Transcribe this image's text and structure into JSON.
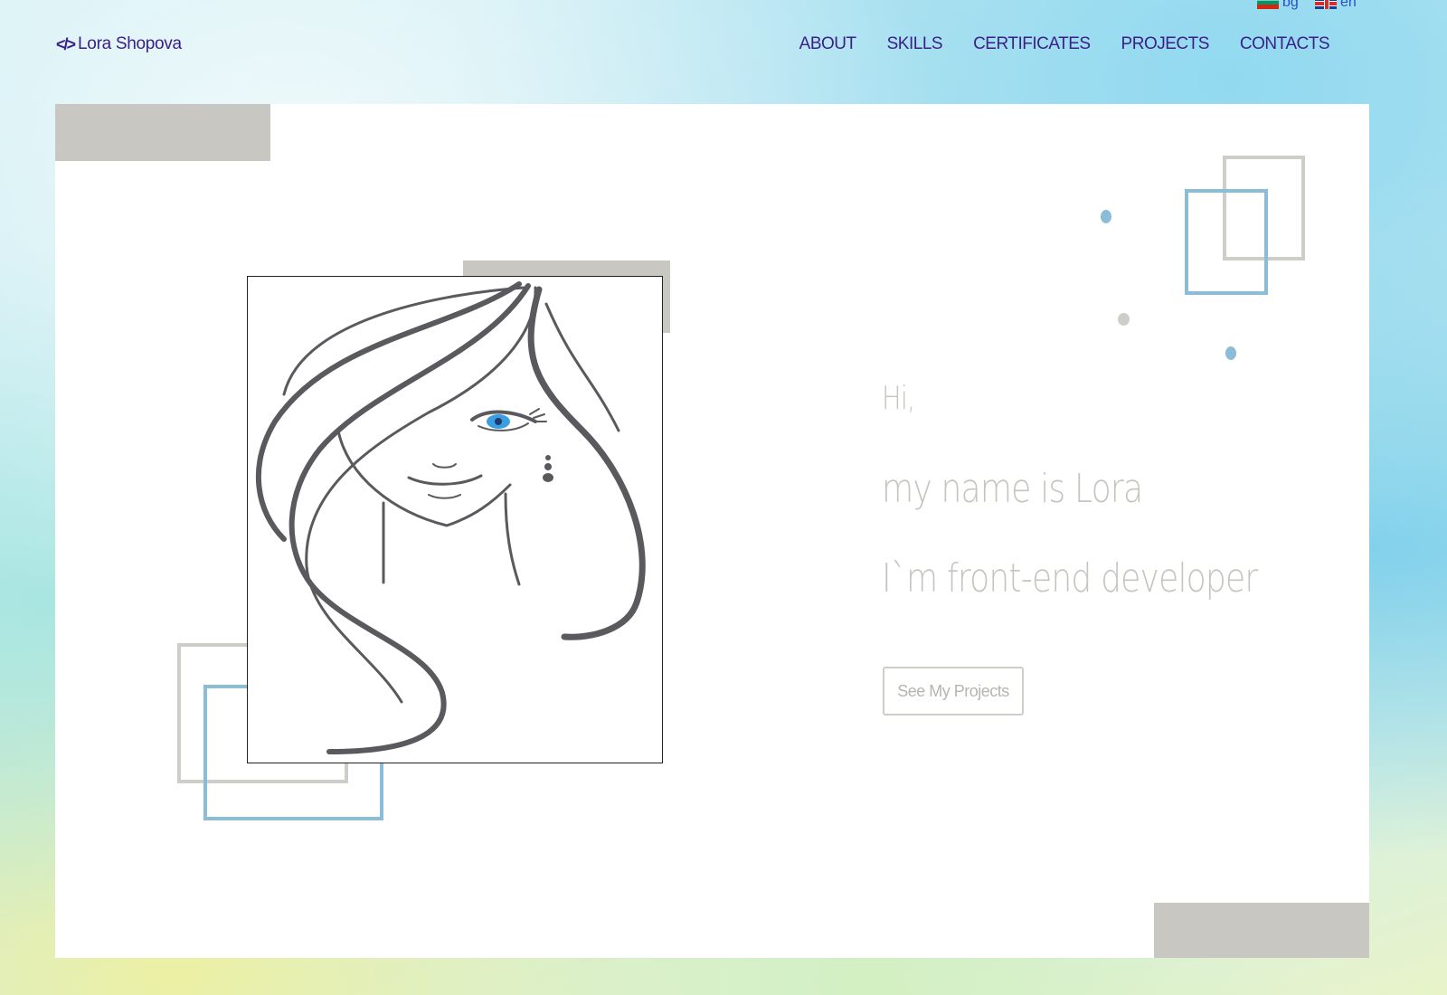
{
  "header": {
    "logo_icon": "</>",
    "logo_text": "Lora Shopova",
    "languages": [
      {
        "code": "bg",
        "label": "bg",
        "icon": "bulgarian-flag-icon"
      },
      {
        "code": "en",
        "label": "en",
        "icon": "uk-flag-icon"
      }
    ],
    "nav": [
      {
        "label": "ABOUT"
      },
      {
        "label": "SKILLS"
      },
      {
        "label": "CERTIFICATES"
      },
      {
        "label": "PROJECTS"
      },
      {
        "label": "CONTACTS"
      }
    ]
  },
  "hero": {
    "greeting": "Hi,",
    "name_line": "my name is Lora",
    "role_line": "I`m front-end developer",
    "cta_label": "See My Projects",
    "illustration": "woman-line-portrait"
  },
  "colors": {
    "brand": "#3a1f8a",
    "accent_blue": "#8bbcd8",
    "accent_gray": "#c9c7c2",
    "hero_text": "#c6c4bf"
  }
}
